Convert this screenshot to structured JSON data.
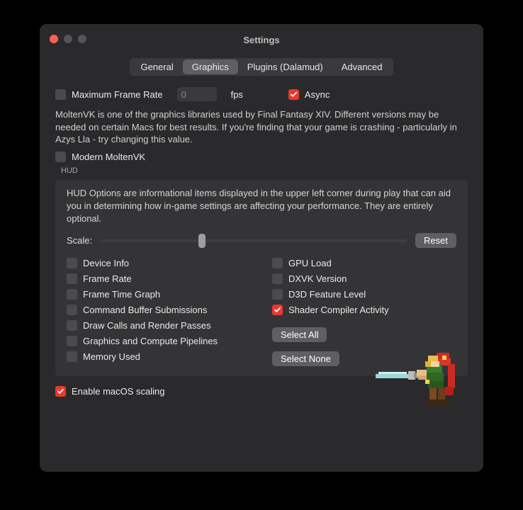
{
  "window": {
    "title": "Settings"
  },
  "tabs": {
    "items": [
      "General",
      "Graphics",
      "Plugins (Dalamud)",
      "Advanced"
    ],
    "active": 1
  },
  "graphics": {
    "max_fps_label": "Maximum Frame Rate",
    "max_fps_value": "0",
    "max_fps_unit": "fps",
    "async_label": "Async",
    "moltenvk_desc": "MoltenVK is one of the graphics libraries used by Final Fantasy XIV. Different versions may be needed on certain Macs for best results. If you're finding that your game is crashing - particularly in Azys Lla - try changing this value.",
    "modern_moltenvk_label": "Modern MoltenVK",
    "enable_macos_scaling_label": "Enable macOS scaling"
  },
  "hud": {
    "legend": "HUD",
    "desc": "HUD Options are informational items displayed in the upper left corner during play that can aid you in determining how in-game settings are affecting your performance. They are entirely optional.",
    "scale_label": "Scale:",
    "reset_label": "Reset",
    "left_items": [
      "Device Info",
      "Frame Rate",
      "Frame Time Graph",
      "Command Buffer Submissions",
      "Draw Calls and Render Passes",
      "Graphics and Compute Pipelines",
      "Memory Used"
    ],
    "right_items": [
      "GPU Load",
      "DXVK Version",
      "D3D Feature Level",
      "Shader Compiler Activity"
    ],
    "right_checked_index": 3,
    "select_all_label": "Select All",
    "select_none_label": "Select None"
  },
  "colors": {
    "accent": "#ed372c"
  }
}
